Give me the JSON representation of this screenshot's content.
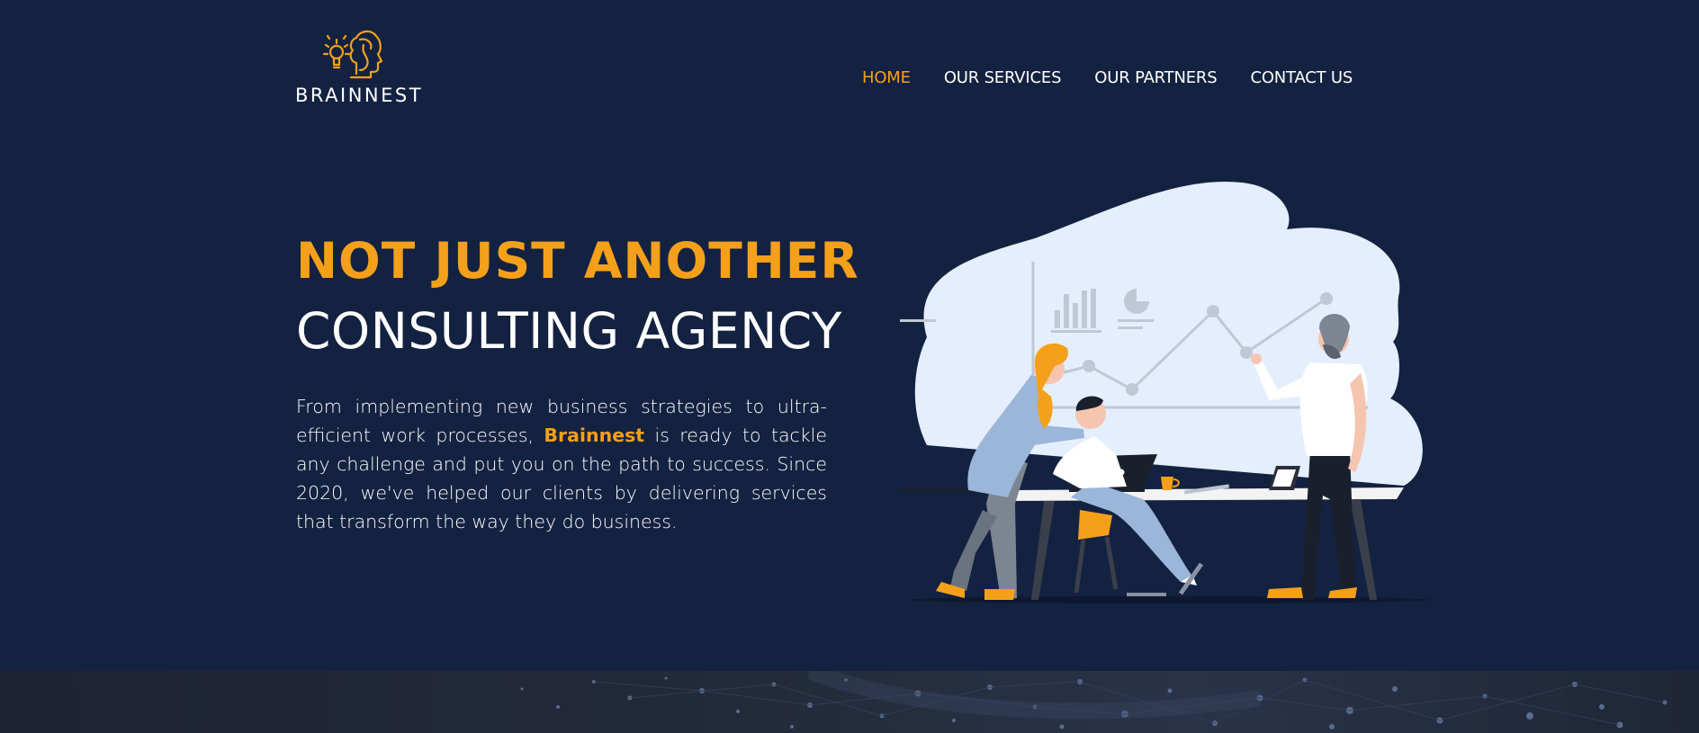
{
  "brand": {
    "name": "BRAINNEST",
    "logo_icon": "lightbulb-head-icon",
    "accent_color": "#f5a01a",
    "background_color": "#142241"
  },
  "nav": {
    "items": [
      {
        "label": "HOME",
        "active": true
      },
      {
        "label": "OUR SERVICES",
        "active": false
      },
      {
        "label": "OUR PARTNERS",
        "active": false
      },
      {
        "label": "CONTACT US",
        "active": false
      }
    ]
  },
  "hero": {
    "title_line1": "NOT JUST ANOTHER",
    "title_line2": "CONSULTING AGENCY",
    "text_before": "From implementing new business strategies to ultra-efficient work processes, ",
    "text_brand": "Brainnest",
    "text_after": " is ready to tackle any challenge and put you on the path to success. Since 2020, we've helped our clients by delivering services that transform the way they do business.",
    "illustration": "team-meeting-illustration"
  }
}
